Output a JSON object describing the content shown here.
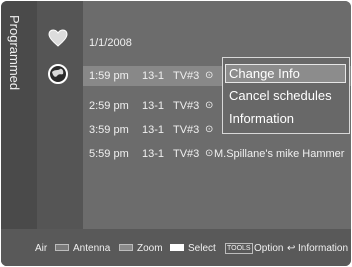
{
  "sidebar": {
    "title": "Programmed"
  },
  "list": {
    "date": "1/1/2008",
    "rows": [
      {
        "time": "1:59 pm",
        "channel": "13-1",
        "name": "TV#3",
        "clock": "⊙",
        "title": ""
      },
      {
        "time": "2:59 pm",
        "channel": "13-1",
        "name": "TV#3",
        "clock": "⊙",
        "title": ""
      },
      {
        "time": "3:59 pm",
        "channel": "13-1",
        "name": "TV#3",
        "clock": "⊙",
        "title": ""
      },
      {
        "time": "5:59 pm",
        "channel": "13-1",
        "name": "TV#3",
        "clock": "⊙",
        "title": "M.Spillane's mike Hammer"
      }
    ]
  },
  "popup": {
    "items": [
      {
        "label": "Change Info",
        "highlighted": true
      },
      {
        "label": "Cancel schedules",
        "highlighted": false
      },
      {
        "label": "Information",
        "highlighted": false
      }
    ]
  },
  "footer": {
    "air": "Air",
    "antenna": "Antenna",
    "zoom": "Zoom",
    "select": "Select",
    "tools_key": "TOOLS",
    "option": "Option",
    "info_symbol": "↩",
    "information": "Information"
  },
  "icons": {
    "first": "heart-icon",
    "second": "globe-icon"
  },
  "colors": {
    "background": "#6c6c6c",
    "selected_row": "#888888",
    "popup_highlight": "#8c8c8c",
    "text": "#f0f0f0"
  }
}
